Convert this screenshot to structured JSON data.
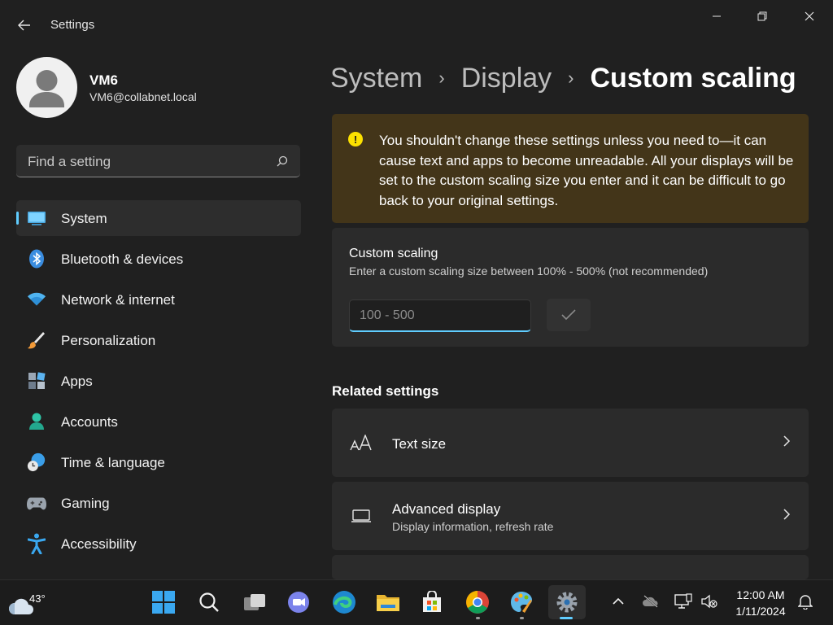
{
  "window": {
    "title": "Settings"
  },
  "profile": {
    "name": "VM6",
    "email": "VM6@collabnet.local"
  },
  "search": {
    "placeholder": "Find a setting"
  },
  "sidebar": {
    "items": [
      {
        "label": "System",
        "icon": "system-icon",
        "active": true
      },
      {
        "label": "Bluetooth & devices",
        "icon": "bluetooth-icon"
      },
      {
        "label": "Network & internet",
        "icon": "wifi-icon"
      },
      {
        "label": "Personalization",
        "icon": "brush-icon"
      },
      {
        "label": "Apps",
        "icon": "apps-icon"
      },
      {
        "label": "Accounts",
        "icon": "accounts-icon"
      },
      {
        "label": "Time & language",
        "icon": "clock-globe-icon"
      },
      {
        "label": "Gaming",
        "icon": "gamepad-icon"
      },
      {
        "label": "Accessibility",
        "icon": "accessibility-icon"
      }
    ]
  },
  "breadcrumb": {
    "items": [
      "System",
      "Display"
    ],
    "current": "Custom scaling"
  },
  "warning": {
    "text": "You shouldn't change these settings unless you need to—it can cause text and apps to become unreadable. All your displays will be set to the custom scaling size you enter and it can be difficult to go back to your original settings."
  },
  "custom_scaling": {
    "title": "Custom scaling",
    "description": "Enter a custom scaling size between 100% - 500% (not recommended)",
    "input_value": "",
    "input_placeholder": "100 - 500"
  },
  "related": {
    "title": "Related settings",
    "items": [
      {
        "title": "Text size",
        "subtitle": "",
        "icon": "text-size-icon"
      },
      {
        "title": "Advanced display",
        "subtitle": "Display information, refresh rate",
        "icon": "laptop-icon"
      }
    ]
  },
  "taskbar": {
    "weather_temp": "43°",
    "time": "12:00 AM",
    "date": "1/11/2024"
  },
  "colors": {
    "accent": "#60cdff",
    "background": "#202020",
    "card": "#2b2b2b",
    "warning_bg": "#433519",
    "warning_icon": "#fce100"
  }
}
